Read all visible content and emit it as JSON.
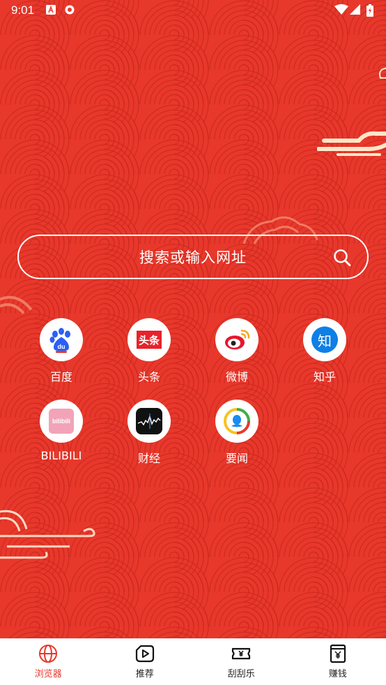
{
  "status_bar": {
    "time": "9:01"
  },
  "search": {
    "placeholder": "搜索或输入网址"
  },
  "shortcuts": [
    {
      "label": "百度",
      "icon": "baidu-icon"
    },
    {
      "label": "头条",
      "icon": "toutiao-icon",
      "icon_text": "头条"
    },
    {
      "label": "微博",
      "icon": "weibo-icon"
    },
    {
      "label": "知乎",
      "icon": "zhihu-icon",
      "icon_text": "知"
    },
    {
      "label": "BILIBILI",
      "icon": "bilibili-icon",
      "icon_text": "bilibili"
    },
    {
      "label": "财经",
      "icon": "finance-icon"
    },
    {
      "label": "要闻",
      "icon": "news-icon"
    }
  ],
  "bottom_nav": [
    {
      "label": "浏览器",
      "icon": "globe-icon",
      "active": true
    },
    {
      "label": "推荐",
      "icon": "play-icon",
      "active": false
    },
    {
      "label": "刮刮乐",
      "icon": "ticket-icon",
      "active": false
    },
    {
      "label": "赚钱",
      "icon": "wallet-icon",
      "active": false
    }
  ],
  "colors": {
    "background": "#e8382b",
    "accent": "#e8382b"
  }
}
